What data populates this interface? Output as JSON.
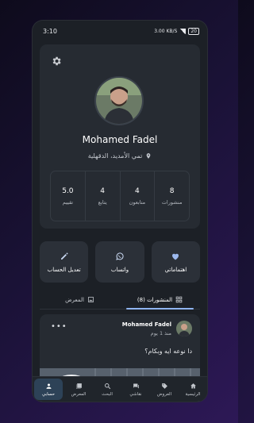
{
  "status_bar": {
    "time": "3:10",
    "network": "3.00 KB/S",
    "battery": "20"
  },
  "profile": {
    "name": "Mohamed Fadel",
    "location": "تمي الأمديد، الدقهلية",
    "stats": [
      {
        "value": "8",
        "label": "منشورات"
      },
      {
        "value": "4",
        "label": "متابعون"
      },
      {
        "value": "4",
        "label": "يتابع"
      },
      {
        "value": "5.0",
        "label": "تقييم"
      }
    ]
  },
  "actions": [
    {
      "label": "اهتماماتي",
      "icon": "heart-icon"
    },
    {
      "label": "واتساب",
      "icon": "whatsapp-icon"
    },
    {
      "label": "تعديل الحساب",
      "icon": "pencil-icon"
    }
  ],
  "tabs": [
    {
      "label": "المنشورات (8)",
      "icon": "grid-icon",
      "active": true
    },
    {
      "label": "المعرض",
      "icon": "gallery-icon",
      "active": false
    }
  ],
  "post": {
    "author": "Mohamed Fadel",
    "time": "منذ 1 يوم",
    "text": "دا نوعه ايه وبكام؟",
    "more": "•••"
  },
  "bottom_nav": [
    {
      "label": "الرئيسية",
      "icon": "home-icon",
      "active": false
    },
    {
      "label": "العروض",
      "icon": "tag-icon",
      "active": false
    },
    {
      "label": "نقاشي",
      "icon": "chat-icon",
      "active": false
    },
    {
      "label": "البحث",
      "icon": "search-icon",
      "active": false
    },
    {
      "label": "المعرض",
      "icon": "gallery-icon",
      "active": false
    },
    {
      "label": "حسابي",
      "icon": "person-icon",
      "active": true
    }
  ],
  "colors": {
    "accent": "#8fb4f0",
    "card": "#262b32",
    "background": "#1c2026"
  }
}
